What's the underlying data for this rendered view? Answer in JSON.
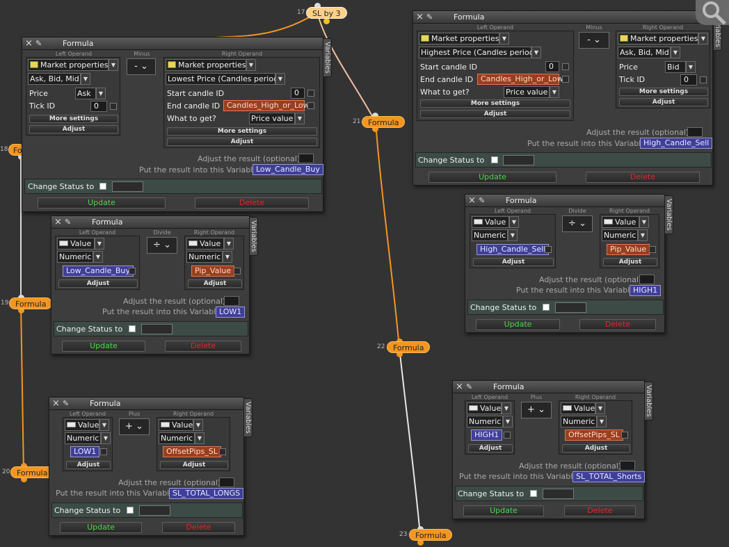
{
  "nodes": {
    "n17": {
      "num": "17",
      "label": "SL by 3"
    },
    "n18": {
      "num": "18",
      "label": "Fo"
    },
    "n19": {
      "num": "19",
      "label": "Formula"
    },
    "n20": {
      "num": "20",
      "label": "Formula"
    },
    "n21": {
      "num": "21",
      "label": "Formula"
    },
    "n22": {
      "num": "22",
      "label": "Formula"
    },
    "n23": {
      "num": "23",
      "label": "Formula"
    }
  },
  "common": {
    "title": "Formula",
    "close_icon": "×",
    "pin_icon": "✎",
    "variables_tab": "Variables",
    "left_operand": "Left Operand",
    "right_operand": "Right Operand",
    "more_settings": "More settings",
    "adjust": "Adjust",
    "adjust_result": "Adjust the result (optional):",
    "put_result": "Put the result into this Variable:",
    "change_status": "Change Status to",
    "update": "Update",
    "delete": "Delete",
    "arrow": "▼",
    "caret": "⌄",
    "market_properties": "Market properties",
    "value": "Value",
    "numeric": "Numeric",
    "start_candle": "Start candle ID",
    "end_candle": "End candle ID",
    "what_to_get": "What to get?",
    "price_value": "Price value",
    "price": "Price",
    "tick_id": "Tick ID"
  },
  "w18": {
    "op": "Minus",
    "op_sym": "-",
    "left_sub": "Ask, Bid, Mid",
    "left_price": "Ask",
    "left_tick": "0",
    "right_sub": "Lowest Price (Candles period)",
    "start": "0",
    "end": "Candles_High_or_Low",
    "result": "Low_Candle_Buy"
  },
  "w21": {
    "op": "Minus",
    "op_sym": "-",
    "left_sub": "Highest Price (Candles period)",
    "start": "0",
    "end": "Candles_High_or_Low",
    "right_sub": "Ask, Bid, Mid",
    "right_price": "Bid",
    "right_tick": "0",
    "result": "High_Candle_Sell"
  },
  "w19": {
    "op": "Divide",
    "op_sym": "÷",
    "left_var": "Low_Candle_Buy",
    "right_var": "Pip_Value",
    "result": "LOW1"
  },
  "w22": {
    "op": "Divide",
    "op_sym": "÷",
    "left_var": "High_Candle_Sell",
    "right_var": "Pip_Value",
    "result": "HIGH1"
  },
  "w20": {
    "op": "Plus",
    "op_sym": "+",
    "left_var": "LOW1",
    "right_var": "OffsetPips_SL",
    "result": "SL_TOTAL_LONGS"
  },
  "w23": {
    "op": "Plus",
    "op_sym": "+",
    "left_var": "HIGH1",
    "right_var": "OffsetPips_SL",
    "result": "SL_TOTAL_Shorts"
  },
  "colors": {
    "node": "#f39621",
    "update": "#4cd64c",
    "delete": "#e02828",
    "var_blue": "#3f3f99",
    "var_red": "#9a3e1e"
  },
  "icons": {
    "gear": "wrench-settings-icon"
  }
}
